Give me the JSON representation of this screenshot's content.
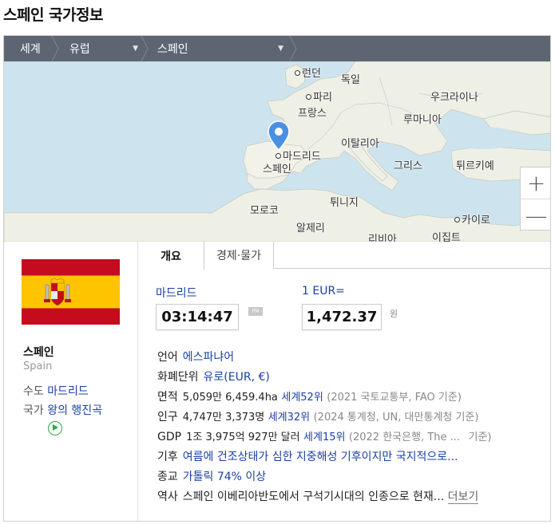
{
  "page": {
    "title": "스페인 국가정보"
  },
  "breadcrumb": {
    "world": "세계",
    "region": "유럽",
    "country": "스페인"
  },
  "map": {
    "labels": {
      "london": "런던",
      "germany": "독일",
      "paris": "파리",
      "france": "프랑스",
      "ukraine": "우크라이나",
      "romania": "루마니아",
      "italy": "이탈리아",
      "madrid": "마드리드",
      "spain": "스페인",
      "greece": "그리스",
      "turkey": "튀르키예",
      "tunisia": "튀니지",
      "morocco": "모로코",
      "algeria": "알제리",
      "cairo": "카이로",
      "libya": "리비아",
      "egypt": "이집트"
    },
    "zoom_in": "+",
    "zoom_out": "—"
  },
  "profile": {
    "name": "스페인",
    "name_en": "Spain",
    "capital_label": "수도",
    "capital_value": "마드리드",
    "anthem_label": "국가",
    "anthem_value": "왕의 행진곡"
  },
  "tabs": {
    "overview": "개요",
    "economy": "경제·물가"
  },
  "clock": {
    "city": "마드리드",
    "time": "03:14:47",
    "ampm": "PM"
  },
  "currency": {
    "label": "1 EUR=",
    "value": "1,472.37",
    "unit": "원"
  },
  "info": {
    "language": {
      "key": "언어",
      "value": "에스파냐어"
    },
    "currency": {
      "key": "화폐단위",
      "value": "유로(EUR, €)"
    },
    "area": {
      "key": "면적",
      "value": "5,059만 6,459.4ha",
      "rank": "세계52위",
      "source": "(2021 국토교통부, FAO 기준)"
    },
    "population": {
      "key": "인구",
      "value": "4,747만 3,373명",
      "rank": "세계32위",
      "source": "(2024 통계청, UN, 대만통계청 기준)"
    },
    "gdp": {
      "key": "GDP",
      "value": "1조 3,975억 927만 달러",
      "rank": "세계15위",
      "source": "(2022 한국은행, The ...",
      "source_tail": "기준)"
    },
    "climate": {
      "key": "기후",
      "value": "여름에 건조상태가 심한 지중해성 기후이지만 국지적으로..."
    },
    "religion": {
      "key": "종교",
      "value": "가톨릭 74% 이상"
    },
    "history": {
      "key": "역사",
      "value": "스페인 이베리아반도에서 구석기시대의 인종으로 현재...",
      "more": "더보기"
    }
  },
  "colors": {
    "link": "#1a3fa8",
    "breadcrumb_bg": "#5d6573",
    "map_water": "#cde4ee",
    "flag_red": "#c60b1e",
    "flag_yellow": "#ffc400"
  }
}
